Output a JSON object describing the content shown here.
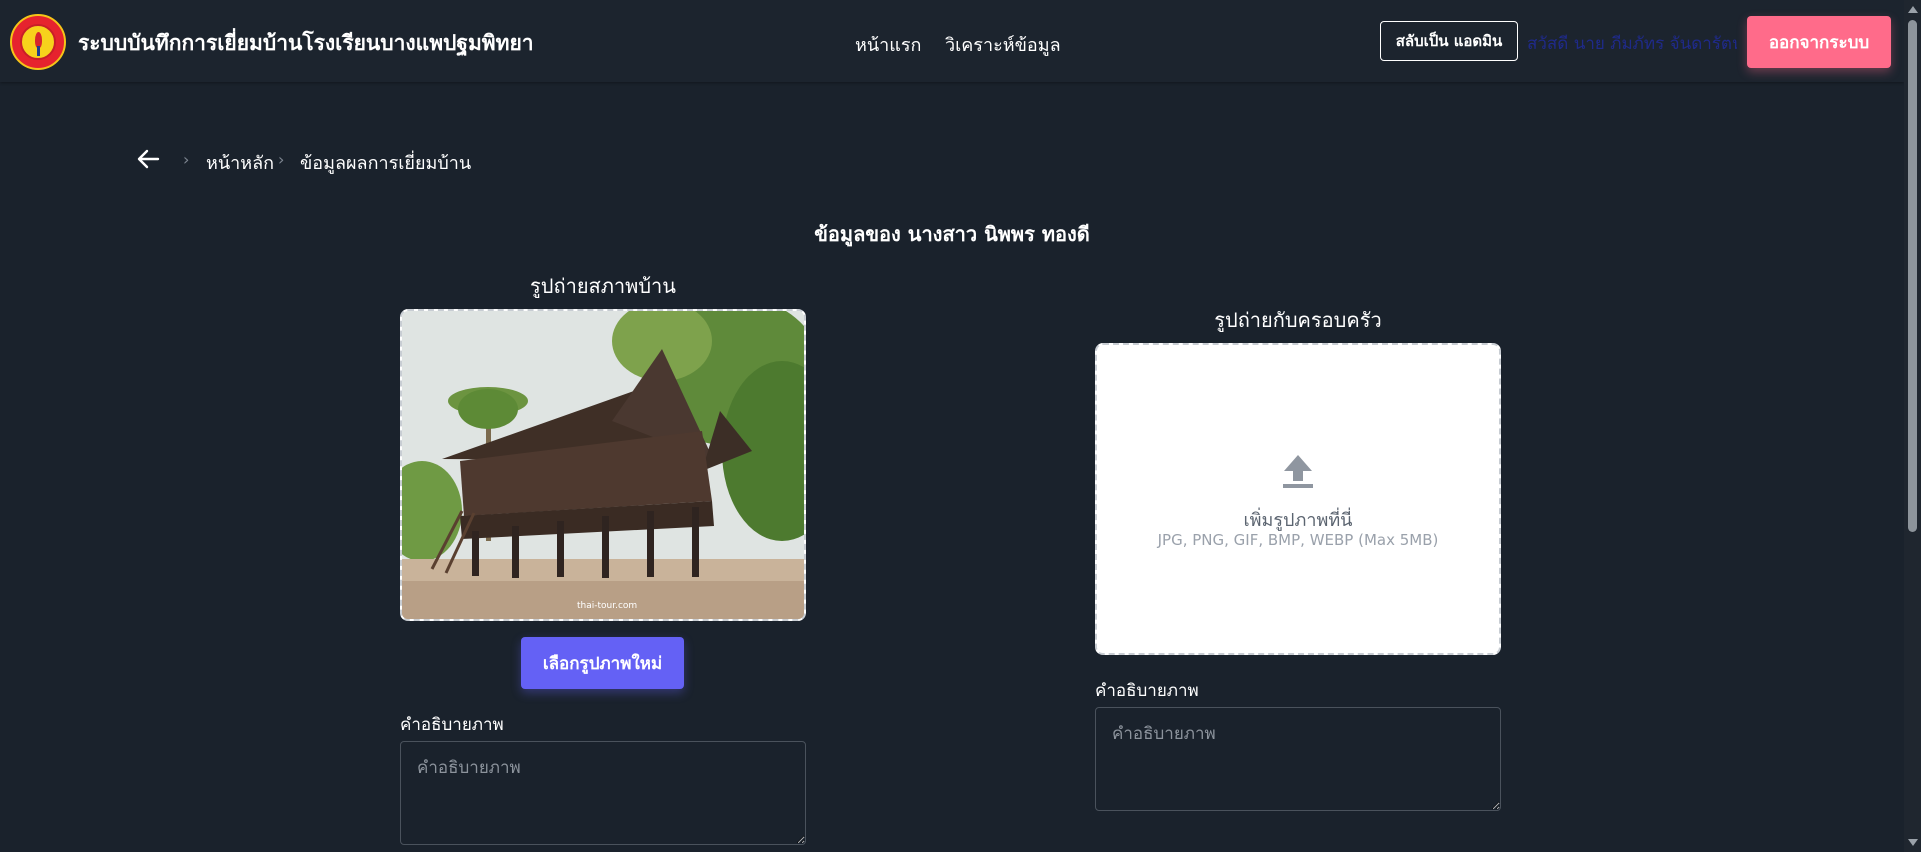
{
  "header": {
    "app_title": "ระบบบันทึกการเยี่ยมบ้านโรงเรียนบางแพปฐมพิทยา",
    "nav": [
      {
        "label": "หน้าแรก"
      },
      {
        "label": "วิเคราะห์ข้อมูล"
      }
    ],
    "switch_admin_label": "สลับเป็น แอดมิน",
    "greeting": "สวัสดี นาย ภีมภัทร จันดารัตน์",
    "logout_label": "ออกจากระบบ"
  },
  "breadcrumb": {
    "items": [
      "หน้าหลัก",
      "ข้อมูลผลการเยี่ยมบ้าน"
    ]
  },
  "student_title": "ข้อมูลของ นางสาว นิพพร ทองดี",
  "house_photo": {
    "title": "รูปถ่ายสภาพบ้าน",
    "watermark": "thai-tour.com",
    "choose_button": "เลือกรูปภาพใหม่",
    "desc_label": "คำอธิบายภาพ",
    "desc_placeholder": "คำอธิบายภาพ"
  },
  "family_photo": {
    "title": "รูปถ่ายกับครอบครัว",
    "upload_text": "เพิ่มรูปภาพที่นี่",
    "upload_hint": "JPG, PNG, GIF, BMP, WEBP (Max 5MB)",
    "desc_label": "คำอธิบายภาพ",
    "desc_placeholder": "คำอธิบายภาพ"
  },
  "colors": {
    "background": "#1a222c",
    "logout": "#ff6b8a",
    "primary": "#6461f5"
  }
}
